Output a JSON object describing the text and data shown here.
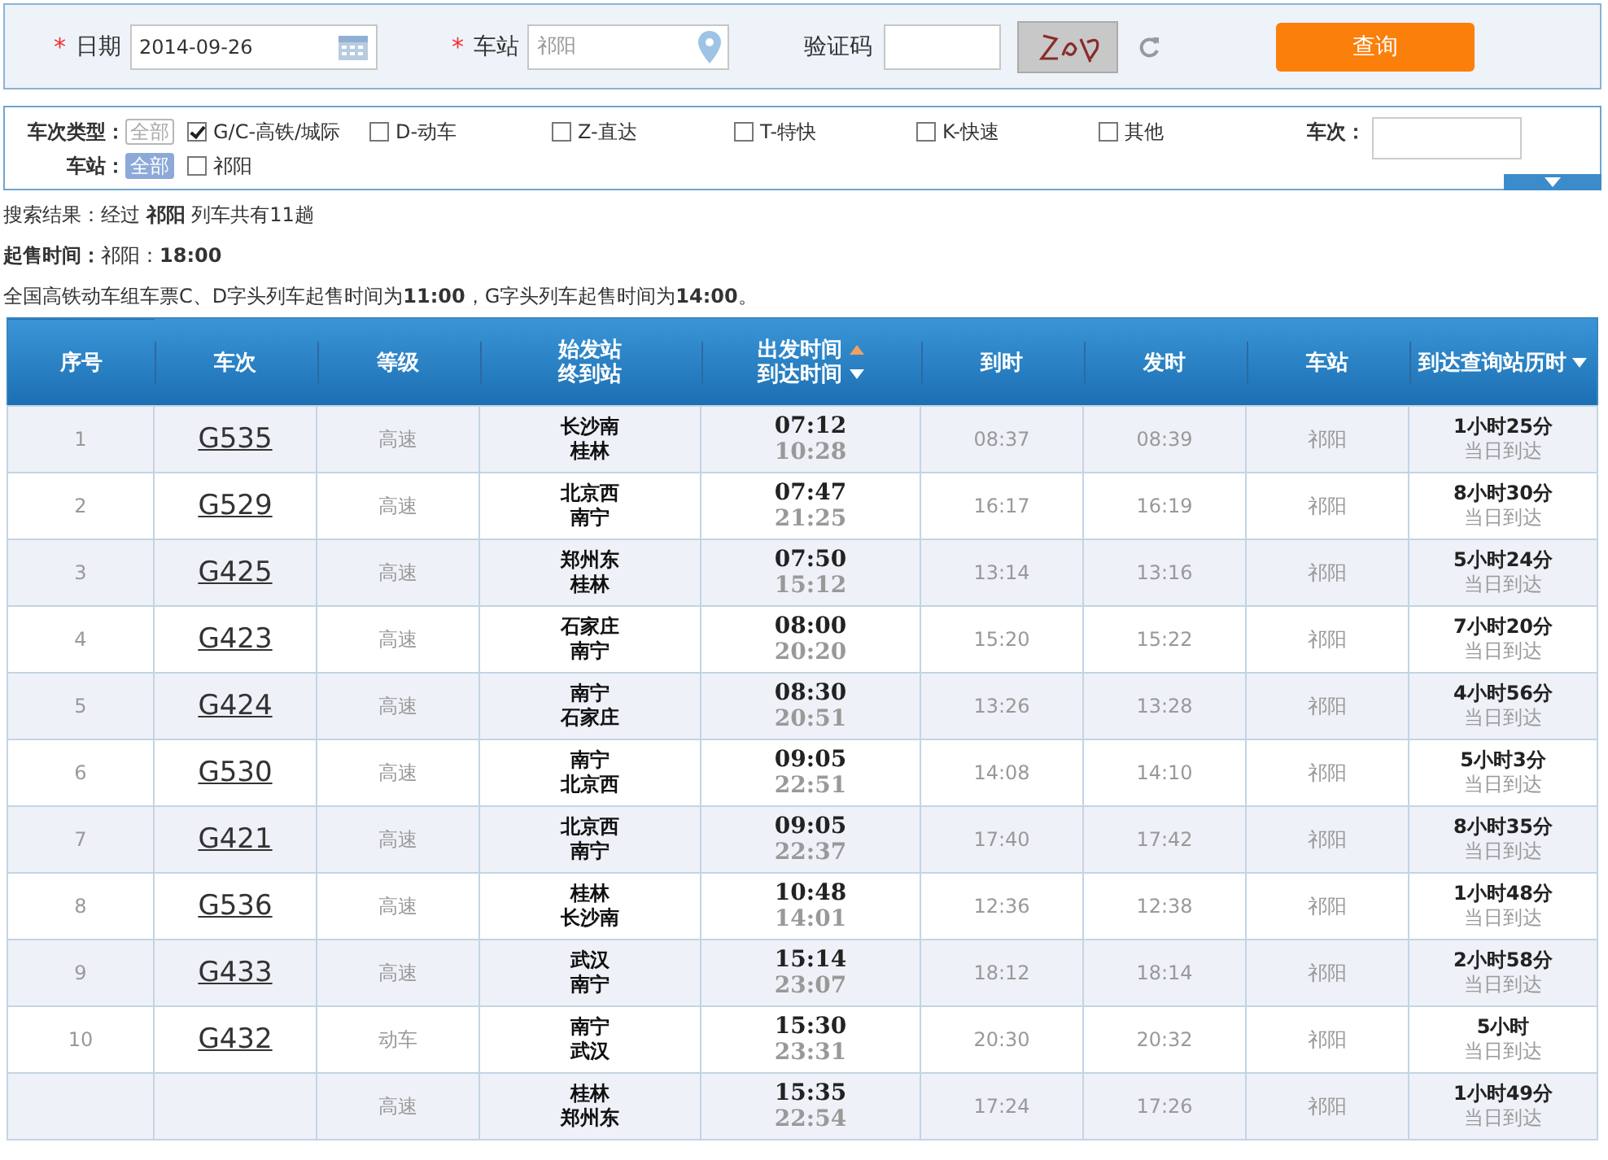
{
  "search": {
    "date_mark": "*",
    "station_mark": "*",
    "date_label": "日期",
    "date_value": "2014-09-26",
    "station_label": "车站",
    "station_value": "祁阳",
    "captcha_label": "验证码",
    "submit": "查询"
  },
  "filters": {
    "type_label": "车次类型：",
    "type_all": "全部",
    "type_all_selected": false,
    "types": [
      {
        "label": "G/C-高铁/城际",
        "checked": true
      },
      {
        "label": "D-动车",
        "checked": false
      },
      {
        "label": "Z-直达",
        "checked": false
      },
      {
        "label": "T-特快",
        "checked": false
      },
      {
        "label": "K-快速",
        "checked": false
      },
      {
        "label": "其他",
        "checked": false
      }
    ],
    "train_label": "车次：",
    "station_label": "车站：",
    "station_all": "全部",
    "station_all_selected": true,
    "stations": [
      {
        "label": "祁阳",
        "checked": false
      }
    ]
  },
  "info": {
    "summary": "搜索结果：经过 **祁阳** 列车共有11趟",
    "sale_time": "**起售时间：**祁阳：**18:00**",
    "notice": "全国高铁动车组车票C、D字头列车起售时间为**11:00**，G字头列车起售时间为**14:00**。"
  },
  "table": {
    "columns": [
      "序号",
      "车次",
      "等级",
      "始发站",
      "终到站",
      "出发时间",
      "到达时间",
      "到时",
      "发时",
      "车站",
      "到达查询站历时"
    ],
    "rows": [
      {
        "seq": "1",
        "train": "G535",
        "grade": "高速",
        "from": "长沙南",
        "to": "桂林",
        "dep": "07:12",
        "arr": "10:28",
        "at": "08:37",
        "leave": "08:39",
        "station": "祁阳",
        "duration": "1小时25分",
        "note": "当日到达"
      },
      {
        "seq": "2",
        "train": "G529",
        "grade": "高速",
        "from": "北京西",
        "to": "南宁",
        "dep": "07:47",
        "arr": "21:25",
        "at": "16:17",
        "leave": "16:19",
        "station": "祁阳",
        "duration": "8小时30分",
        "note": "当日到达"
      },
      {
        "seq": "3",
        "train": "G425",
        "grade": "高速",
        "from": "郑州东",
        "to": "桂林",
        "dep": "07:50",
        "arr": "15:12",
        "at": "13:14",
        "leave": "13:16",
        "station": "祁阳",
        "duration": "5小时24分",
        "note": "当日到达"
      },
      {
        "seq": "4",
        "train": "G423",
        "grade": "高速",
        "from": "石家庄",
        "to": "南宁",
        "dep": "08:00",
        "arr": "20:20",
        "at": "15:20",
        "leave": "15:22",
        "station": "祁阳",
        "duration": "7小时20分",
        "note": "当日到达"
      },
      {
        "seq": "5",
        "train": "G424",
        "grade": "高速",
        "from": "南宁",
        "to": "石家庄",
        "dep": "08:30",
        "arr": "20:51",
        "at": "13:26",
        "leave": "13:28",
        "station": "祁阳",
        "duration": "4小时56分",
        "note": "当日到达"
      },
      {
        "seq": "6",
        "train": "G530",
        "grade": "高速",
        "from": "南宁",
        "to": "北京西",
        "dep": "09:05",
        "arr": "22:51",
        "at": "14:08",
        "leave": "14:10",
        "station": "祁阳",
        "duration": "5小时3分",
        "note": "当日到达"
      },
      {
        "seq": "7",
        "train": "G421",
        "grade": "高速",
        "from": "北京西",
        "to": "南宁",
        "dep": "09:05",
        "arr": "22:37",
        "at": "17:40",
        "leave": "17:42",
        "station": "祁阳",
        "duration": "8小时35分",
        "note": "当日到达"
      },
      {
        "seq": "8",
        "train": "G536",
        "grade": "高速",
        "from": "桂林",
        "to": "长沙南",
        "dep": "10:48",
        "arr": "14:01",
        "at": "12:36",
        "leave": "12:38",
        "station": "祁阳",
        "duration": "1小时48分",
        "note": "当日到达"
      },
      {
        "seq": "9",
        "train": "G433",
        "grade": "高速",
        "from": "武汉",
        "to": "南宁",
        "dep": "15:14",
        "arr": "23:07",
        "at": "18:12",
        "leave": "18:14",
        "station": "祁阳",
        "duration": "2小时58分",
        "note": "当日到达"
      },
      {
        "seq": "10",
        "train": "G432",
        "grade": "动车",
        "from": "南宁",
        "to": "武汉",
        "dep": "15:30",
        "arr": "23:31",
        "at": "20:30",
        "leave": "20:32",
        "station": "祁阳",
        "duration": "5小时",
        "note": "当日到达"
      },
      {
        "grade": "高速",
        "from": "桂林",
        "to": "郑州东",
        "dep": "15:35",
        "arr": "22:54",
        "at": "17:24",
        "leave": "17:26",
        "station": "祁阳",
        "duration": "1小时49分",
        "note": "当日到达"
      }
    ]
  }
}
